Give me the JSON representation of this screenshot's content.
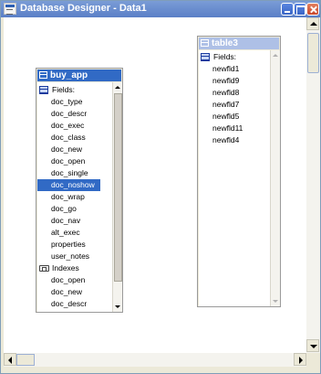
{
  "window": {
    "title": "Database Designer - Data1",
    "app_icon": "database-designer-icon"
  },
  "tables": [
    {
      "name": "buy_app",
      "icon": "table-icon",
      "state": "active",
      "sections": [
        {
          "label": "Fields:",
          "icon": "fields-icon",
          "items": [
            "doc_type",
            "doc_descr",
            "doc_exec",
            "doc_class",
            "doc_new",
            "doc_open",
            "doc_single",
            "doc_noshow",
            "doc_wrap",
            "doc_go",
            "doc_nav",
            "alt_exec",
            "properties",
            "user_notes"
          ]
        },
        {
          "label": "Indexes",
          "icon": "indexes-icon",
          "items": [
            "doc_open",
            "doc_new",
            "doc_descr"
          ]
        }
      ],
      "selected_item": "doc_noshow"
    },
    {
      "name": "table3",
      "icon": "table-icon",
      "state": "inactive",
      "sections": [
        {
          "label": "Fields:",
          "icon": "fields-icon",
          "items": [
            "newfld1",
            "newfld9",
            "newfld8",
            "newfld7",
            "newfld5",
            "newfld11",
            "newfld4"
          ]
        }
      ]
    }
  ],
  "colors": {
    "accent": "#316ac5",
    "inactive_header": "#aec0e6",
    "titlebar": "#5a7fc7"
  }
}
